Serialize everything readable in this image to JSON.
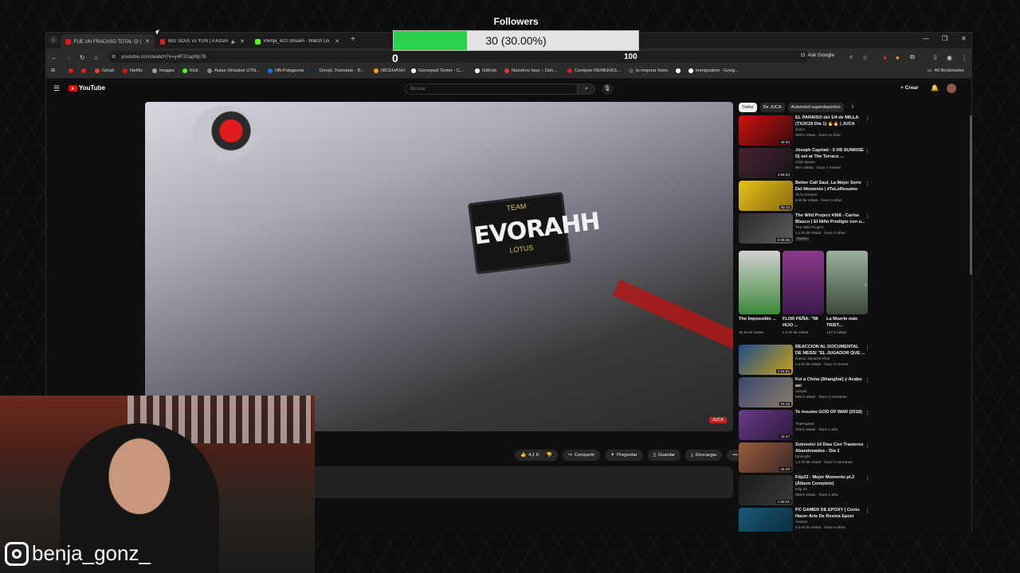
{
  "followers": {
    "label": "Followers",
    "bar_text": "30 (30.00%)",
    "progress": 0.3,
    "min": "0",
    "max": "100",
    "fill_color": "#2ad14a"
  },
  "browser": {
    "tabs": [
      {
        "title": "FUE UN FRACASO TOTAL 😥 | ",
        "fav": "#e31b1b"
      },
      {
        "title": "BIG SOUL vs YUN | #JUGAR",
        "fav": "#e31b1b"
      },
      {
        "title": "Plenja_420 Stream - Watch Liv",
        "fav": "#53fc18"
      }
    ],
    "url": "youtube.com/watch?v=y4F31ap5p78",
    "ask_google": "Ask Google",
    "bookmarks": [
      {
        "label": "Gmail",
        "color": "#ea4335"
      },
      {
        "label": "Netflix",
        "color": "#e50914"
      },
      {
        "label": "Images",
        "color": "#9aa0a6"
      },
      {
        "label": "Kick",
        "color": "#53fc18"
      },
      {
        "label": "Aulas Virtuales UTN...",
        "color": "#888888"
      },
      {
        "label": "HB-Patagonia",
        "color": "#1a73e8"
      },
      {
        "label": "DeepL Translate - B...",
        "color": "#0f2b46"
      },
      {
        "label": "NICEHASH",
        "color": "#f7a600"
      },
      {
        "label": "Gamepad Tester - C...",
        "color": "#ffffff"
      },
      {
        "label": "GitHub",
        "color": "#ffffff"
      },
      {
        "label": "Nuestros favs – Deli...",
        "color": "#e33"
      },
      {
        "label": "Comprar REMERAS...",
        "color": "#c22"
      },
      {
        "label": "la mejorar fotos",
        "color": "#555555"
      },
      {
        "label": "",
        "color": "#ffffff"
      },
      {
        "label": "immigration - Goog...",
        "color": "#ffffff"
      }
    ],
    "all_bookmarks": "All Bookmarks"
  },
  "youtube": {
    "logo": "YouTube",
    "search_placeholder": "Buscar",
    "create": "Crear",
    "plate_text": "EVORAHH",
    "plate_top": "TEAM",
    "plate_bottom": "LOTUS",
    "watermark": "JUCA",
    "actions": [
      "4,1 K",
      "",
      "Compartir",
      "Preguntar",
      "Guardar",
      "Descargar",
      "•••"
    ],
    "chips": [
      "Todos",
      "De JUCA",
      "Automóvil superdeportivo"
    ],
    "recs_top": [
      {
        "title": "EL PARAÍSO del 1/4 de MILLA (TX2K26 Día 1) 🔥🔥 | JUCA",
        "channel": "JUCA",
        "meta": "399 k vistas · hace 11 días",
        "dur": "44:52",
        "color": "#8b1a1a"
      },
      {
        "title": "Joseph Capriati - 5 HS SUNRISE Dj set at The Terrace ...",
        "channel": "Club Space",
        "meta": "56 k vistas · hace 7 meses",
        "dur": "4:59:34",
        "color": "#3a2030"
      },
      {
        "title": "Better Call Saul, La Mejor Serie Del Momento | #TeLoResumo",
        "channel": "Te lo resumo",
        "meta": "8 M de vistas · hace 3 años",
        "dur": "40:13",
        "color": "#c8a21a"
      },
      {
        "title": "The Wild Project #368 - Carlos Blasco | El Niño Prodigio con u...",
        "channel": "The Wild Project",
        "meta": "1,1 M de vistas · hace 3 años",
        "badge": "Nuevo",
        "dur": "6:25:35",
        "color": "#2c2c2c"
      }
    ],
    "shorts": [
      {
        "title": "The Impossible ...",
        "views": "18 M de vistas",
        "color": "#3d8a3a"
      },
      {
        "title": "FLOR PEÑA: \"MI HIJO ...",
        "views": "1,5 M de vistas",
        "color": "#6a2a6a"
      },
      {
        "title": "La Muerte más TRIST...",
        "views": "127 k vistas",
        "color": "#4d6a4a"
      }
    ],
    "recs_bottom": [
      {
        "title": "REACCION AL DOCUMENTAL DE MESSI \"EL JUGADOR QUE ...",
        "channel": "Davoo Xeneize Plus",
        "meta": "1,2 M de vistas · hace 9 meses",
        "dur": "1:04:51",
        "color": "#1e4a8a"
      },
      {
        "title": "Fui a China (Shanghai) y Acabo así",
        "channel": "rotsuki",
        "meta": "506 k vistas · hace 2 semanas",
        "dur": "24:15",
        "color": "#3b4a6e"
      },
      {
        "title": "Te resumo GOD OF WAR (2018)",
        "channel": "ThePophet",
        "meta": "219 k vistas · hace 1 año",
        "dur": "18:47",
        "color": "#5a3a6a"
      },
      {
        "title": "Sobreviví 14 Días Con Trasteros Abandonados - Día 1",
        "channel": "byViruZz",
        "meta": "1,2 M de vistas · hace 2 semanas",
        "dur": "45:49",
        "color": "#7a3a2a"
      },
      {
        "title": "Fdp22 - Mejor Momento pt.2 (Álbum Completo)",
        "channel": "Fdp 22",
        "meta": "865 k vistas · hace 1 año",
        "dur": "1:05:01",
        "color": "#1a1a1a"
      },
      {
        "title": "PC GAMER DE EPOXY | Como Hacer Arte De Resina Epoxi",
        "channel": "roseart",
        "meta": "4,9 M de vistas · hace 5 años",
        "dur": "",
        "color": "#1a5a7a"
      }
    ]
  },
  "social": {
    "handle": "benja_gonz_"
  }
}
